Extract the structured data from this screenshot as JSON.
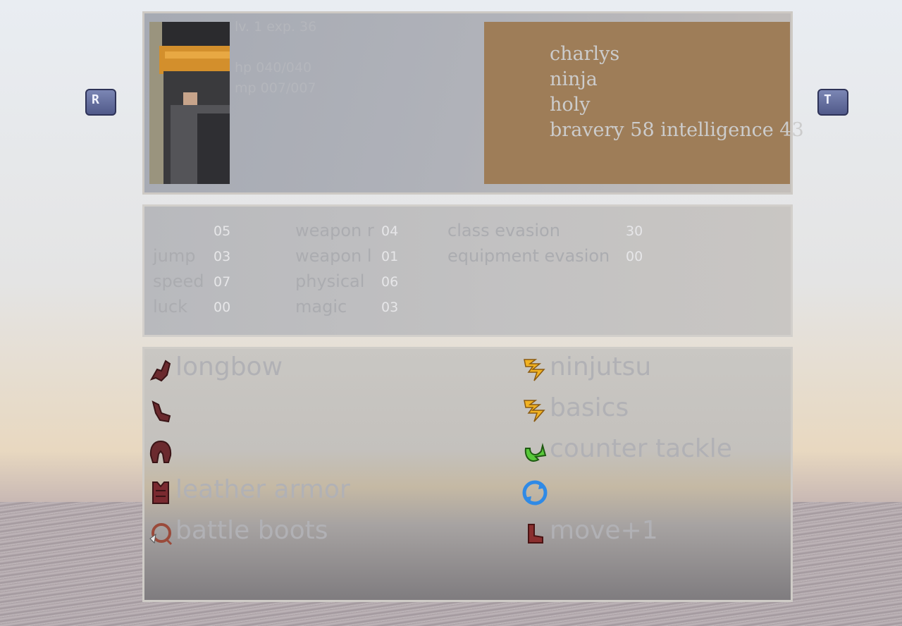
{
  "buttons": {
    "left_label": "R",
    "right_label": "T"
  },
  "header": {
    "level_exp": "lv. 1 exp. 36",
    "hp": "hp 040/040",
    "mp": "mp 007/007",
    "name": "charlys",
    "job": "ninja",
    "element": "holy",
    "brave_faith": "bravery 58 intelligence 43"
  },
  "stats": {
    "col1": [
      {
        "label": "",
        "value": "05"
      },
      {
        "label": "jump",
        "value": "03"
      },
      {
        "label": "speed",
        "value": "07"
      },
      {
        "label": "luck",
        "value": "00"
      }
    ],
    "col2": [
      {
        "label": "weapon r",
        "value": "04"
      },
      {
        "label": "weapon l",
        "value": "01"
      },
      {
        "label": "physical",
        "value": "06"
      },
      {
        "label": "magic",
        "value": "03"
      }
    ],
    "col3": [
      {
        "label": "class evasion",
        "value": "30"
      },
      {
        "label": "equipment evasion",
        "value": "00"
      }
    ]
  },
  "equipment": [
    {
      "icon": "weapon-right-icon",
      "name": "longbow"
    },
    {
      "icon": "weapon-left-icon",
      "name": ""
    },
    {
      "icon": "helmet-icon",
      "name": ""
    },
    {
      "icon": "armor-icon",
      "name": "leather armor"
    },
    {
      "icon": "accessory-icon",
      "name": "battle boots"
    }
  ],
  "abilities": [
    {
      "icon": "primary-skill-icon",
      "name": "ninjutsu"
    },
    {
      "icon": "secondary-skill-icon",
      "name": "basics"
    },
    {
      "icon": "reaction-icon",
      "name": "counter tackle"
    },
    {
      "icon": "support-icon",
      "name": ""
    },
    {
      "icon": "movement-icon",
      "name": "move+1"
    }
  ],
  "colors": {
    "name_box": "#9e7d58",
    "value_text": "#e6e6e8",
    "label_text": "#abacb0"
  }
}
